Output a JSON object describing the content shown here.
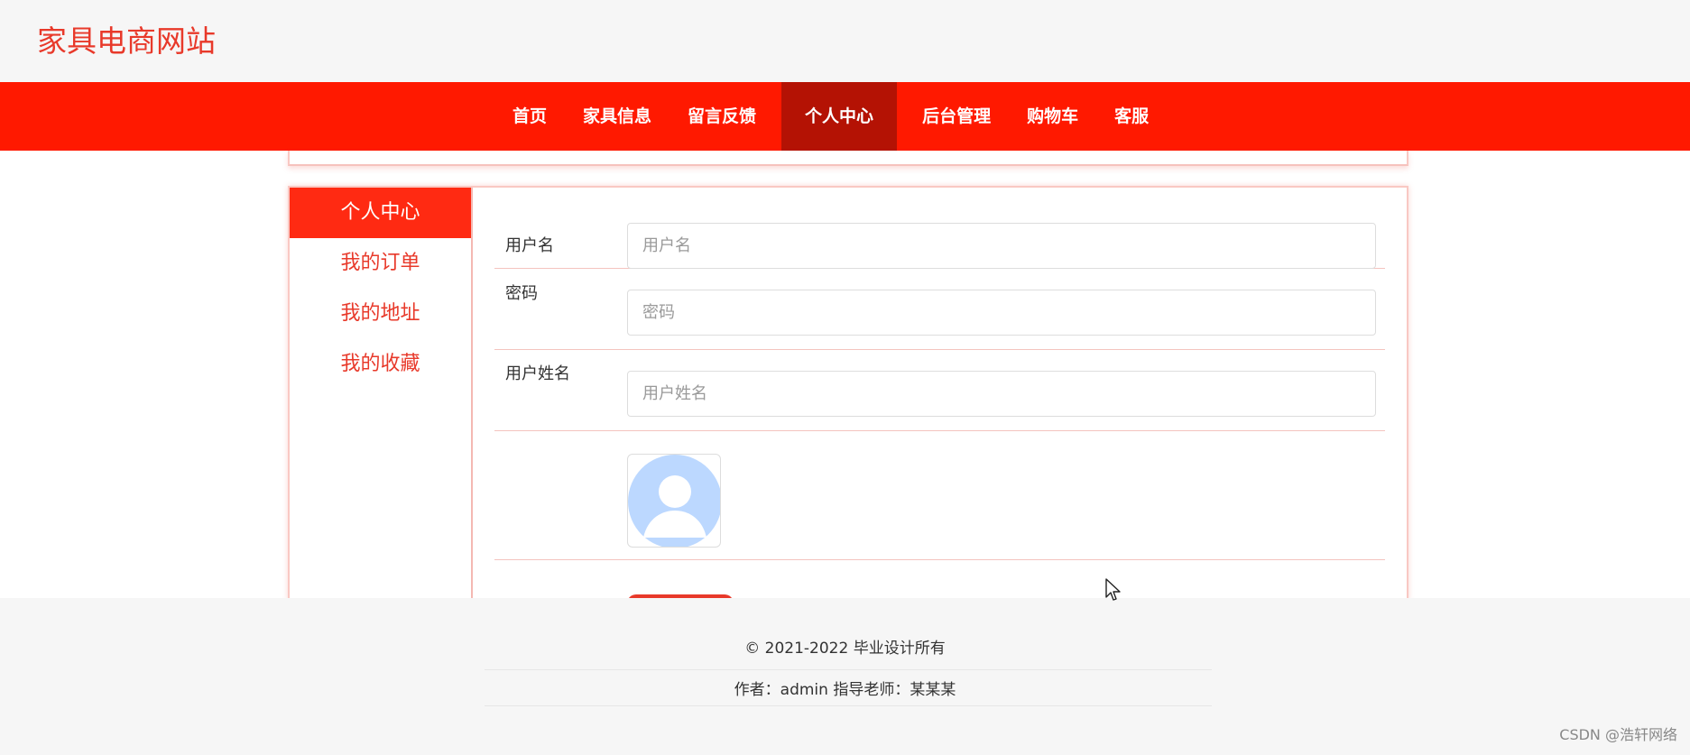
{
  "header": {
    "site_title": "家具电商网站"
  },
  "nav": {
    "items": [
      {
        "label": "首页"
      },
      {
        "label": "家具信息"
      },
      {
        "label": "留言反馈"
      },
      {
        "label": "个人中心",
        "active": true
      },
      {
        "label": "后台管理"
      },
      {
        "label": "购物车"
      },
      {
        "label": "客服"
      }
    ]
  },
  "sidebar": {
    "items": [
      {
        "label": "个人中心",
        "active": true
      },
      {
        "label": "我的订单"
      },
      {
        "label": "我的地址"
      },
      {
        "label": "我的收藏"
      }
    ]
  },
  "form": {
    "username": {
      "label": "用户名",
      "placeholder": "用户名",
      "value": ""
    },
    "password": {
      "label": "密码",
      "placeholder": "密码",
      "value": ""
    },
    "fullname": {
      "label": "用户姓名",
      "placeholder": "用户姓名",
      "value": ""
    },
    "avatar_icon": "default-avatar-icon"
  },
  "footer": {
    "copyright": "© 2021-2022 毕业设计所有",
    "author": "作者：admin 指导老师：某某某"
  },
  "watermark": "CSDN @浩轩网络",
  "colors": {
    "accent": "#ff1900",
    "accent_dark": "#b41204",
    "title_red": "#e8392a",
    "avatar_blue": "#bcd8ff"
  }
}
